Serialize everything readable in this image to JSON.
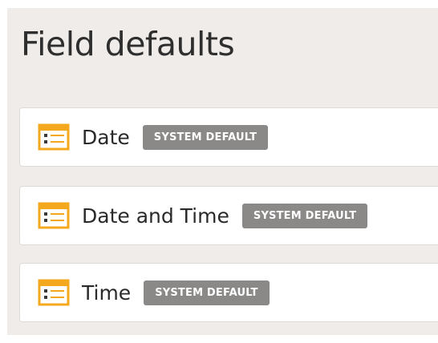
{
  "page": {
    "title": "Field defaults"
  },
  "colors": {
    "icon_accent": "#f4a81d",
    "badge_bg": "#8b8987",
    "panel_bg": "#efecea"
  },
  "items": [
    {
      "label": "Date",
      "badge": "SYSTEM DEFAULT",
      "icon": "form-field-icon"
    },
    {
      "label": "Date and Time",
      "badge": "SYSTEM DEFAULT",
      "icon": "form-field-icon"
    },
    {
      "label": "Time",
      "badge": "SYSTEM DEFAULT",
      "icon": "form-field-icon"
    }
  ]
}
